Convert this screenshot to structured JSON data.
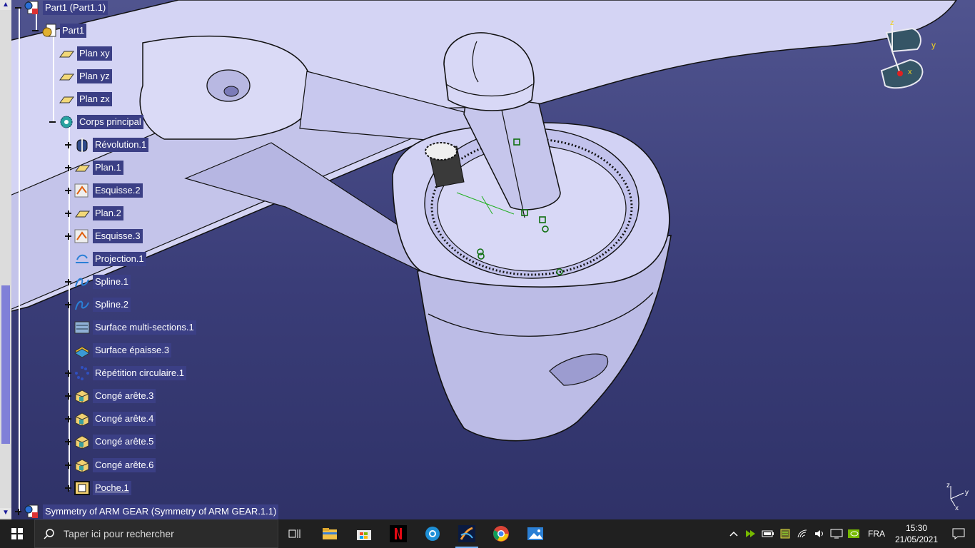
{
  "app": {
    "name": "CATIA V5"
  },
  "tree": {
    "root": {
      "label": "Part1 (Part1.1)"
    },
    "part": {
      "label": "Part1"
    },
    "items": [
      {
        "label": "Plan xy",
        "icon": "plane-icon"
      },
      {
        "label": "Plan yz",
        "icon": "plane-icon"
      },
      {
        "label": "Plan zx",
        "icon": "plane-icon"
      },
      {
        "label": "Corps principal",
        "icon": "body-gear-icon"
      },
      {
        "label": "Révolution.1",
        "icon": "revolution-icon"
      },
      {
        "label": "Plan.1",
        "icon": "plane-icon"
      },
      {
        "label": "Esquisse.2",
        "icon": "sketch-icon"
      },
      {
        "label": "Plan.2",
        "icon": "plane-icon"
      },
      {
        "label": "Esquisse.3",
        "icon": "sketch-icon"
      },
      {
        "label": "Projection.1",
        "icon": "projection-icon"
      },
      {
        "label": "Spline.1",
        "icon": "spline-icon"
      },
      {
        "label": "Spline.2",
        "icon": "spline-icon"
      },
      {
        "label": "Surface multi-sections.1",
        "icon": "multi-section-surface-icon"
      },
      {
        "label": "Surface épaisse.3",
        "icon": "thick-surface-icon"
      },
      {
        "label": "Répétition circulaire.1",
        "icon": "circular-pattern-icon"
      },
      {
        "label": "Congé arête.3",
        "icon": "edge-fillet-icon"
      },
      {
        "label": "Congé arête.4",
        "icon": "edge-fillet-icon"
      },
      {
        "label": "Congé arête.5",
        "icon": "edge-fillet-icon"
      },
      {
        "label": "Congé arête.6",
        "icon": "edge-fillet-icon"
      },
      {
        "label": "Poche.1",
        "icon": "pocket-icon"
      }
    ],
    "symmetry": {
      "label": "Symmetry of ARM GEAR (Symmetry of ARM GEAR.1.1)"
    }
  },
  "compass": {
    "x_label": "x",
    "y_label": "y",
    "z_label": "z"
  },
  "axis_triad": {
    "x_label": "x",
    "y_label": "y",
    "z_label": "z"
  },
  "taskbar": {
    "search_placeholder": "Taper ici pour rechercher",
    "apps": [
      "start-icon",
      "task-view-icon",
      "file-explorer-icon",
      "microsoft-store-icon",
      "netflix-icon",
      "edge-icon",
      "catia-icon",
      "chrome-icon",
      "photos-icon"
    ],
    "language": "FRA",
    "time": "15:30",
    "date": "21/05/2021"
  },
  "colors": {
    "tree_label_bg": "#3b3f85",
    "viewport_bg": "#3a3d78",
    "part_fill": "#c9c9ef",
    "taskbar_bg": "#202020"
  }
}
